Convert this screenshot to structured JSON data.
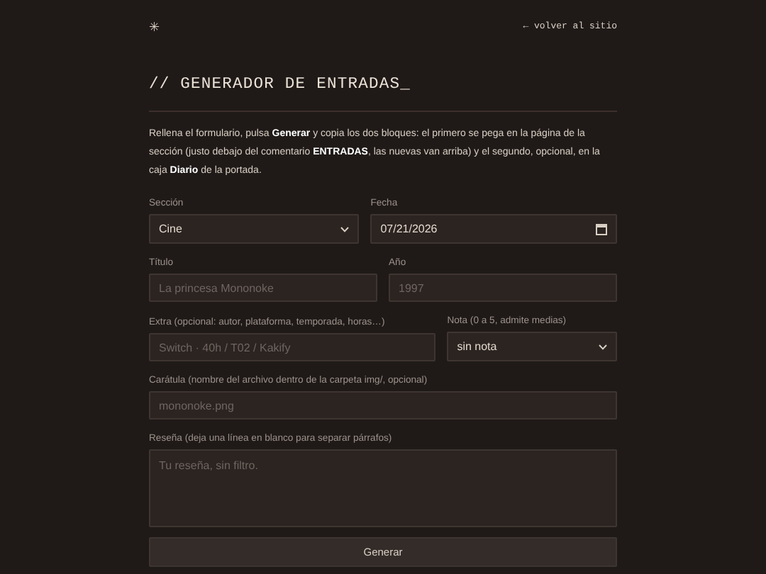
{
  "header": {
    "logo": "✳",
    "back_link": "← volver al sitio"
  },
  "title": "// GENERADOR DE ENTRADAS_",
  "intro": "Rellena el formulario, pulsa **Generar** y copia los dos bloques: el primero se pega en la página de la sección (justo debajo del comentario **ENTRADAS**, las nuevas van arriba) y el segundo, opcional, en la caja **Diario** de la portada.",
  "form_rows": [
    [
      {
        "kind": "select",
        "label": "Sección",
        "value": "Cine"
      },
      {
        "kind": "date",
        "label": "Fecha",
        "value": "07/21/2026"
      }
    ],
    [
      {
        "kind": "text",
        "label": "Título",
        "placeholder": "La princesa Mononoke"
      },
      {
        "kind": "text",
        "label": "Año",
        "placeholder": "1997"
      }
    ],
    [
      {
        "kind": "text",
        "label": "Extra (opcional: autor, plataforma, temporada, horas…)",
        "placeholder": "Switch · 40h / T02 / Kakify"
      },
      {
        "kind": "select",
        "label": "Nota (0 a 5, admite medias)",
        "value": "sin nota"
      }
    ],
    [
      {
        "kind": "text",
        "label": "Carátula (nombre del archivo dentro de la carpeta img/, opcional)",
        "placeholder": "mononoke.png"
      }
    ],
    [
      {
        "kind": "textarea",
        "label": "Reseña (deja una línea en blanco para separar párrafos)",
        "placeholder": "Tu reseña, sin filtro."
      }
    ]
  ],
  "submit": "Generar"
}
